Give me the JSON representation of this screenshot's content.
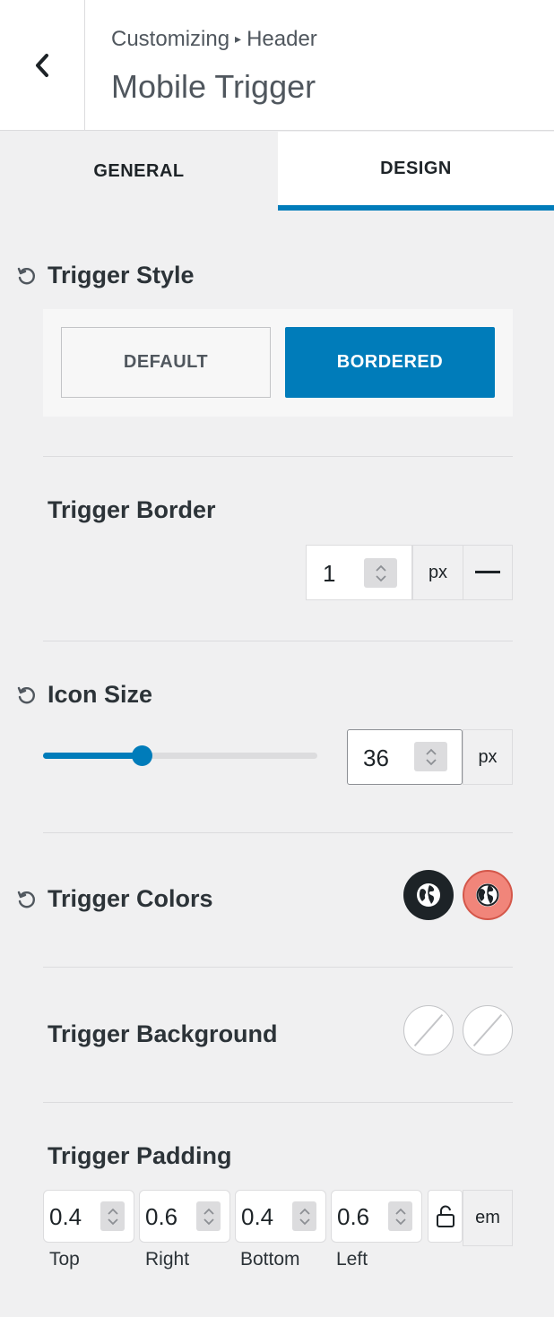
{
  "header": {
    "breadcrumb_root": "Customizing",
    "breadcrumb_separator": "▸",
    "breadcrumb_section": "Header",
    "title": "Mobile Trigger"
  },
  "tabs": [
    {
      "label": "GENERAL",
      "active": false
    },
    {
      "label": "DESIGN",
      "active": true
    }
  ],
  "trigger_style": {
    "label": "Trigger Style",
    "options": [
      "DEFAULT",
      "BORDERED"
    ],
    "selected": "BORDERED"
  },
  "trigger_border": {
    "label": "Trigger Border",
    "value": "1",
    "unit": "px",
    "style_icon": "solid-line-icon"
  },
  "icon_size": {
    "label": "Icon Size",
    "value": "36",
    "unit": "px",
    "slider_fraction": 0.36
  },
  "trigger_colors": {
    "label": "Trigger Colors",
    "swatches": [
      {
        "icon": "globe-icon",
        "color": "#1d2327"
      },
      {
        "icon": "globe-icon",
        "color": "#f1857a"
      }
    ]
  },
  "trigger_background": {
    "label": "Trigger Background",
    "swatches": [
      {
        "icon": "no-color-icon"
      },
      {
        "icon": "no-color-icon"
      }
    ]
  },
  "trigger_padding": {
    "label": "Trigger Padding",
    "unit": "em",
    "sides": [
      {
        "value": "0.4",
        "label": "Top"
      },
      {
        "value": "0.6",
        "label": "Right"
      },
      {
        "value": "0.4",
        "label": "Bottom"
      },
      {
        "value": "0.6",
        "label": "Left"
      }
    ],
    "linked": false
  },
  "colors": {
    "accent": "#007cba",
    "text": "#1d2327",
    "panel_bg": "#f0f0f1"
  }
}
